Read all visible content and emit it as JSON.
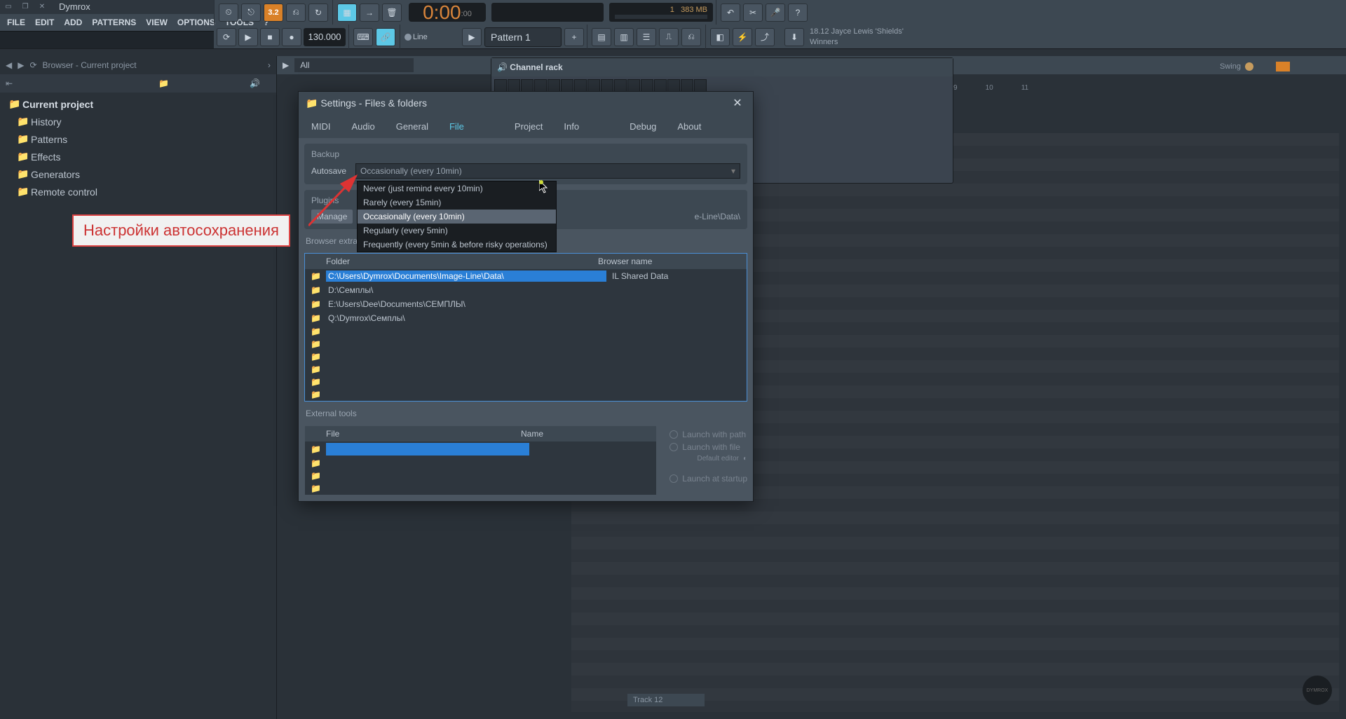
{
  "project_name": "Dymrox",
  "menu": [
    "FILE",
    "EDIT",
    "ADD",
    "PATTERNS",
    "VIEW",
    "OPTIONS",
    "TOOLS",
    "?"
  ],
  "snap_value": "3.2",
  "snap_mode": "Line",
  "tempo": "130.000",
  "time": {
    "main": "0:00",
    "ms": ":00"
  },
  "cpu": "1",
  "mem": "383 MB",
  "pattern": "Pattern 1",
  "song": {
    "version": "18.12",
    "artist": "Jayce Lewis 'Shields'",
    "title": "Winners"
  },
  "browser": {
    "title": "Browser - Current project",
    "root": "Current project",
    "items": [
      "History",
      "Patterns",
      "Effects",
      "Generators",
      "Remote control"
    ]
  },
  "playlist_filter": "All",
  "channel_rack_title": "Channel rack",
  "swing_label": "Swing",
  "ruler": [
    "9",
    "10",
    "11"
  ],
  "settings": {
    "title": "Settings - Files & folders",
    "tabs": [
      "MIDI",
      "Audio",
      "General",
      "File",
      "Project",
      "Info",
      "Debug",
      "About"
    ],
    "active_tab": "File",
    "sections": {
      "backup": "Backup",
      "plugins": "Plugins",
      "browser_extra": "Browser extra search folders",
      "external": "External tools"
    },
    "autosave_label": "Autosave",
    "autosave_value": "Occasionally (every 10min)",
    "autosave_options": [
      "Never (just remind every 10min)",
      "Rarely (every 15min)",
      "Occasionally (every 10min)",
      "Regularly (every 5min)",
      "Frequently (every 5min & before risky operations)"
    ],
    "manage_label": "Manage",
    "manage_path_tail": "e-Line\\Data\\",
    "folder_headers": {
      "folder": "Folder",
      "name": "Browser name"
    },
    "folders": [
      {
        "path": "C:\\Users\\Dymrox\\Documents\\Image-Line\\Data\\",
        "name": "IL Shared Data",
        "selected": true
      },
      {
        "path": "D:\\Семплы\\",
        "name": ""
      },
      {
        "path": "E:\\Users\\Dee\\Documents\\СЕМПЛЫ\\",
        "name": ""
      },
      {
        "path": "Q:\\Dymrox\\Семплы\\",
        "name": ""
      }
    ],
    "ext_headers": {
      "file": "File",
      "name": "Name"
    },
    "launch": {
      "path": "Launch with path",
      "file": "Launch with file",
      "default": "Default editor",
      "startup": "Launch at startup"
    }
  },
  "annotation": "Настройки автосохранения",
  "track_label": "Track 12",
  "watermark": "DYMROX"
}
